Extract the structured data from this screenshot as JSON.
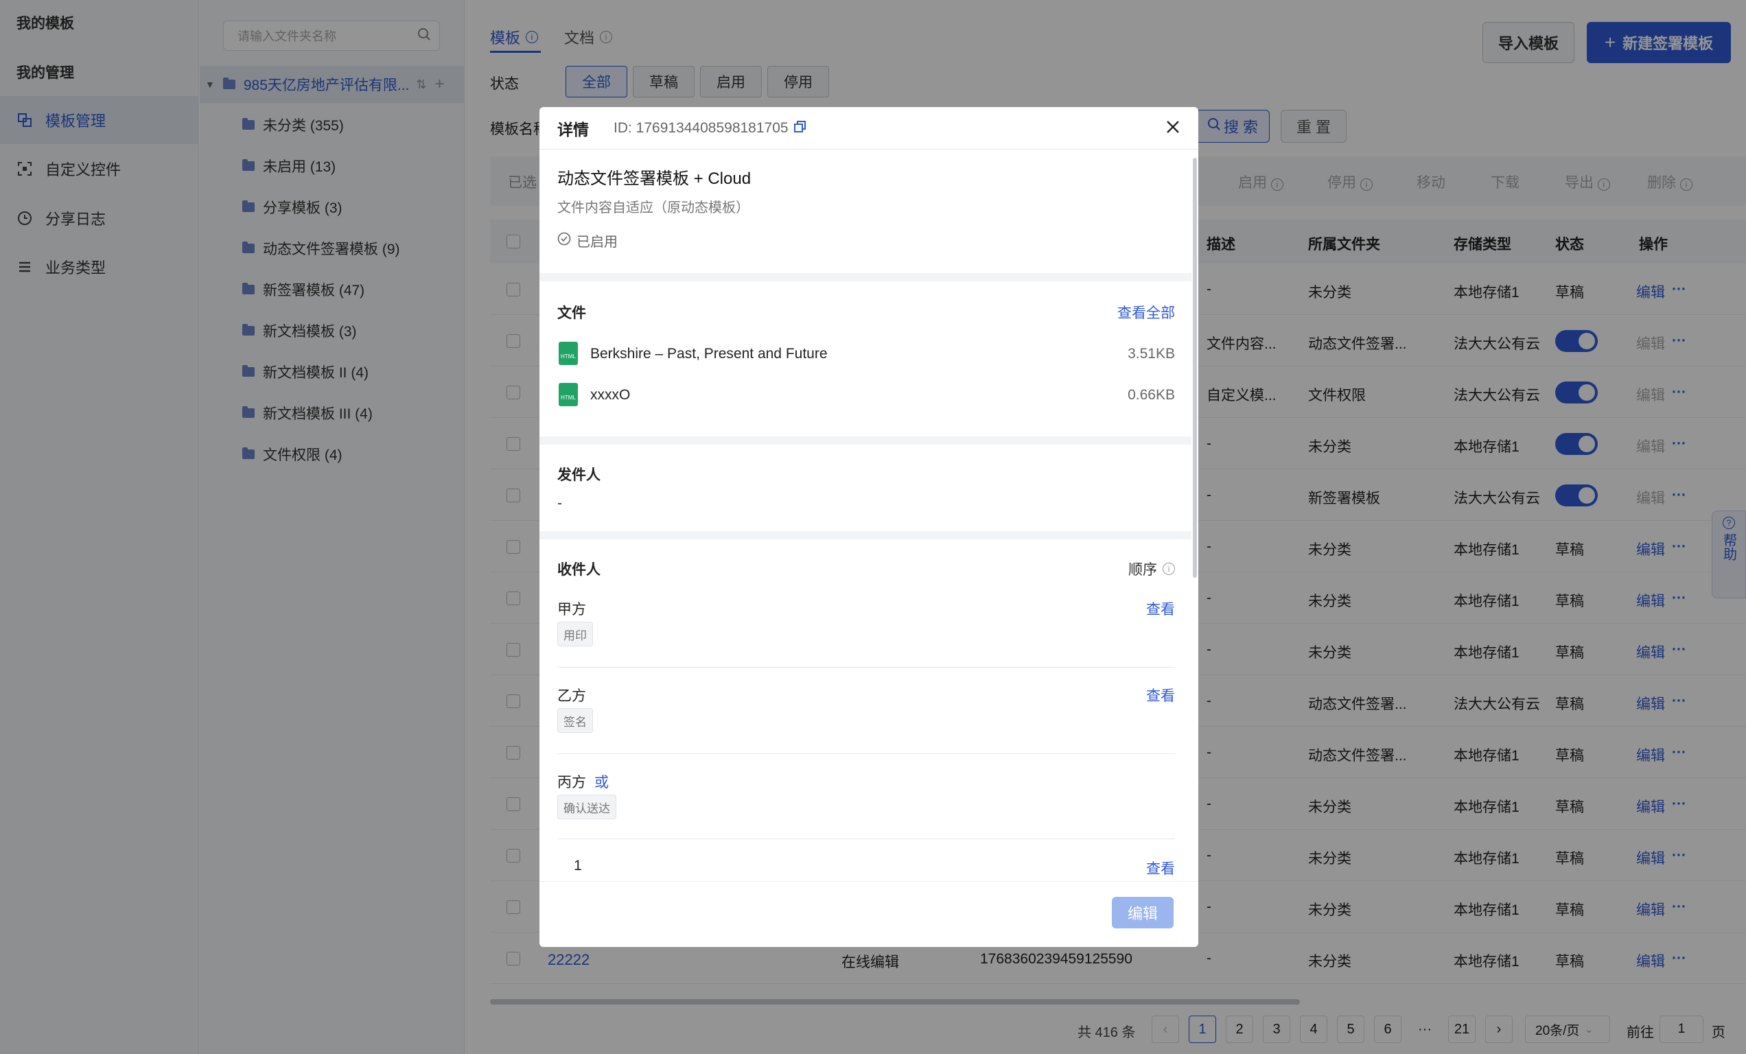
{
  "nav": {
    "my_templates": "我的模板",
    "my_management": "我的管理",
    "items": [
      {
        "label": "模板管理",
        "icon": "template-icon"
      },
      {
        "label": "自定义控件",
        "icon": "control-icon"
      },
      {
        "label": "分享日志",
        "icon": "clock-icon"
      },
      {
        "label": "业务类型",
        "icon": "list-icon"
      }
    ]
  },
  "tree": {
    "search_placeholder": "请输入文件夹名称",
    "root": "985天亿房地产评估有限...",
    "folders": [
      "未分类 (355)",
      "未启用 (13)",
      "分享模板 (3)",
      "动态文件签署模板 (9)",
      "新签署模板 (47)",
      "新文档模板 (3)",
      "新文档模板 II (4)",
      "新文档模板 III (4)",
      "文件权限 (4)"
    ]
  },
  "main": {
    "tabs": [
      "模板",
      "文档"
    ],
    "import_btn": "导入模板",
    "new_btn": "新建签署模板",
    "status_label": "状态",
    "status_chips": [
      "全部",
      "草稿",
      "启用",
      "停用"
    ],
    "name_label": "模板名称",
    "search_btn": "搜 索",
    "reset_btn": "重 置",
    "selected_label": "已选",
    "bulk_actions": [
      "启用",
      "停用",
      "移动",
      "下载",
      "导出",
      "删除"
    ],
    "columns": [
      "描述",
      "所属文件夹",
      "存储类型",
      "状态",
      "操作"
    ],
    "rows": [
      {
        "desc": "-",
        "folder": "未分类",
        "storage": "本地存储1",
        "status": "草稿",
        "toggle": false,
        "edit_disabled": false
      },
      {
        "desc": "文件内容...",
        "folder": "动态文件签署...",
        "storage": "法大大公有云",
        "status": "",
        "toggle": true,
        "edit_disabled": true
      },
      {
        "desc": "自定义模...",
        "folder": "文件权限",
        "storage": "法大大公有云",
        "status": "",
        "toggle": true,
        "edit_disabled": true
      },
      {
        "desc": "-",
        "folder": "未分类",
        "storage": "本地存储1",
        "status": "",
        "toggle": true,
        "edit_disabled": true
      },
      {
        "desc": "-",
        "folder": "新签署模板",
        "storage": "法大大公有云",
        "status": "",
        "toggle": true,
        "edit_disabled": true
      },
      {
        "desc": "-",
        "folder": "未分类",
        "storage": "本地存储1",
        "status": "草稿",
        "toggle": false,
        "edit_disabled": false
      },
      {
        "desc": "-",
        "folder": "未分类",
        "storage": "本地存储1",
        "status": "草稿",
        "toggle": false,
        "edit_disabled": false
      },
      {
        "desc": "-",
        "folder": "未分类",
        "storage": "本地存储1",
        "status": "草稿",
        "toggle": false,
        "edit_disabled": false
      },
      {
        "desc": "-",
        "folder": "动态文件签署...",
        "storage": "法大大公有云",
        "status": "草稿",
        "toggle": false,
        "edit_disabled": false
      },
      {
        "desc": "-",
        "folder": "动态文件签署...",
        "storage": "本地存储1",
        "status": "草稿",
        "toggle": false,
        "edit_disabled": false
      },
      {
        "desc": "-",
        "folder": "未分类",
        "storage": "本地存储1",
        "status": "草稿",
        "toggle": false,
        "edit_disabled": false
      },
      {
        "desc": "-",
        "folder": "未分类",
        "storage": "本地存储1",
        "status": "草稿",
        "toggle": false,
        "edit_disabled": false
      },
      {
        "desc": "-",
        "folder": "未分类",
        "storage": "本地存储1",
        "status": "草稿",
        "toggle": false,
        "edit_disabled": false
      },
      {
        "desc": "-",
        "folder": "未分类",
        "storage": "本地存储1",
        "status": "草稿",
        "toggle": false,
        "edit_disabled": false
      }
    ],
    "last_row": {
      "name": "22222",
      "type": "在线编辑",
      "id": "1768360239459125590"
    },
    "edit_label": "编辑",
    "more_label": "···",
    "pagination": {
      "total": "共 416 条",
      "pages": [
        "1",
        "2",
        "3",
        "4",
        "5",
        "6",
        "···",
        "21"
      ],
      "current": "1",
      "per_page": "20条/页",
      "goto_label": "前往",
      "goto_value": "1",
      "page_suffix": "页"
    },
    "help": "帮助"
  },
  "modal": {
    "title": "详情",
    "id_label": "ID: 1769134408598181705",
    "template_name": "动态文件签署模板 + Cloud",
    "template_desc": "文件内容自适应（原动态模板）",
    "status": "已启用",
    "files_title": "文件",
    "view_all": "查看全部",
    "files": [
      {
        "name": "Berkshire – Past, Present and Future",
        "size": "3.51KB"
      },
      {
        "name": "xxxxO",
        "size": "0.66KB"
      }
    ],
    "sender_title": "发件人",
    "sender_value": "-",
    "recipients_title": "收件人",
    "order_label": "顺序",
    "recipients": [
      {
        "name": "甲方",
        "tag": "用印",
        "action": "查看"
      },
      {
        "name": "乙方",
        "tag": "签名",
        "action": "查看"
      },
      {
        "name": "丙方",
        "or": "或",
        "tag": "确认送达"
      }
    ],
    "sub_row": {
      "value": "1",
      "action": "查看"
    },
    "edit_btn": "编辑",
    "file_icon_text": "HTML"
  }
}
